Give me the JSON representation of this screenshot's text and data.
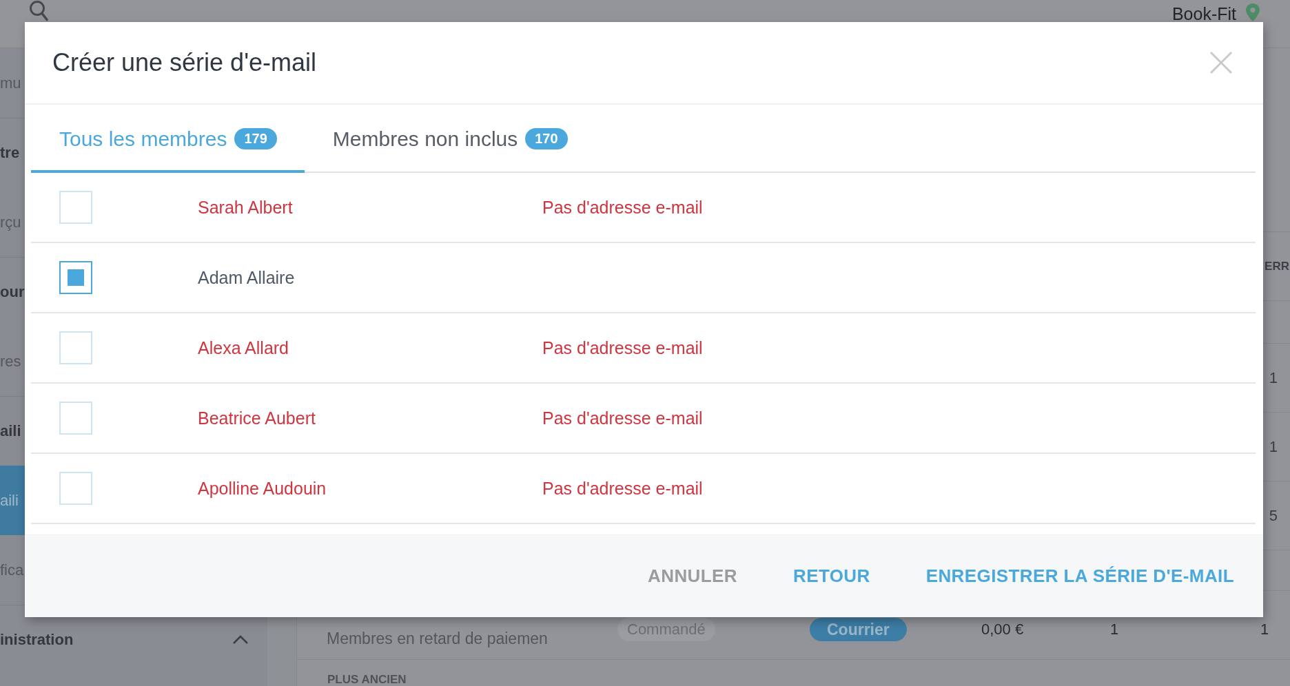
{
  "background": {
    "top_bar": {
      "account": "Book-Fit"
    },
    "sidebar": {
      "items": [
        {
          "label": "mu",
          "kind": "item",
          "selected": false
        },
        {
          "label": "tre",
          "kind": "section",
          "selected": false
        },
        {
          "label": "rçu",
          "kind": "item",
          "selected": false
        },
        {
          "label": "our",
          "kind": "section",
          "selected": false
        },
        {
          "label": "res",
          "kind": "item",
          "selected": false
        },
        {
          "label": "aili",
          "kind": "section",
          "selected": false
        },
        {
          "label": "aili",
          "kind": "item",
          "selected": true
        },
        {
          "label": "fica",
          "kind": "item",
          "selected": false
        },
        {
          "label": "inistration",
          "kind": "section",
          "selected": false,
          "expanded": true
        }
      ]
    },
    "table_edge": {
      "header": "ERR",
      "cells": [
        "1",
        "1",
        "5"
      ]
    },
    "list_row": {
      "subtitle": "Membres en retard de paiemen",
      "status": "Commandé",
      "channel": "Courrier",
      "amount": "0,00 €",
      "column_5": "1",
      "column_6": "1"
    },
    "group_label": "PLUS ANCIEN"
  },
  "dialog": {
    "title": "Créer une série d'e-mail",
    "tabs": [
      {
        "label": "Tous les membres",
        "count": "179",
        "selected": true
      },
      {
        "label": "Membres non inclus",
        "count": "170",
        "selected": false
      }
    ],
    "members": [
      {
        "name": "Sarah Albert",
        "email_status": "Pas d'adresse e-mail",
        "checked": false,
        "missing_email": true
      },
      {
        "name": "Adam Allaire",
        "checked": true,
        "missing_email": false
      },
      {
        "name": "Alexa Allard",
        "email_status": "Pas d'adresse e-mail",
        "checked": false,
        "missing_email": true
      },
      {
        "name": "Beatrice Aubert",
        "email_status": "Pas d'adresse e-mail",
        "checked": false,
        "missing_email": true
      },
      {
        "name": "Apolline Audouin",
        "email_status": "Pas d'adresse e-mail",
        "checked": false,
        "missing_email": true
      }
    ],
    "buttons": [
      {
        "label": "ANNULER",
        "kind": "cancel"
      },
      {
        "label": "RETOUR",
        "kind": "back"
      },
      {
        "label": "ENREGISTRER LA SÉRIE D'E-MAIL",
        "kind": "save"
      }
    ]
  }
}
